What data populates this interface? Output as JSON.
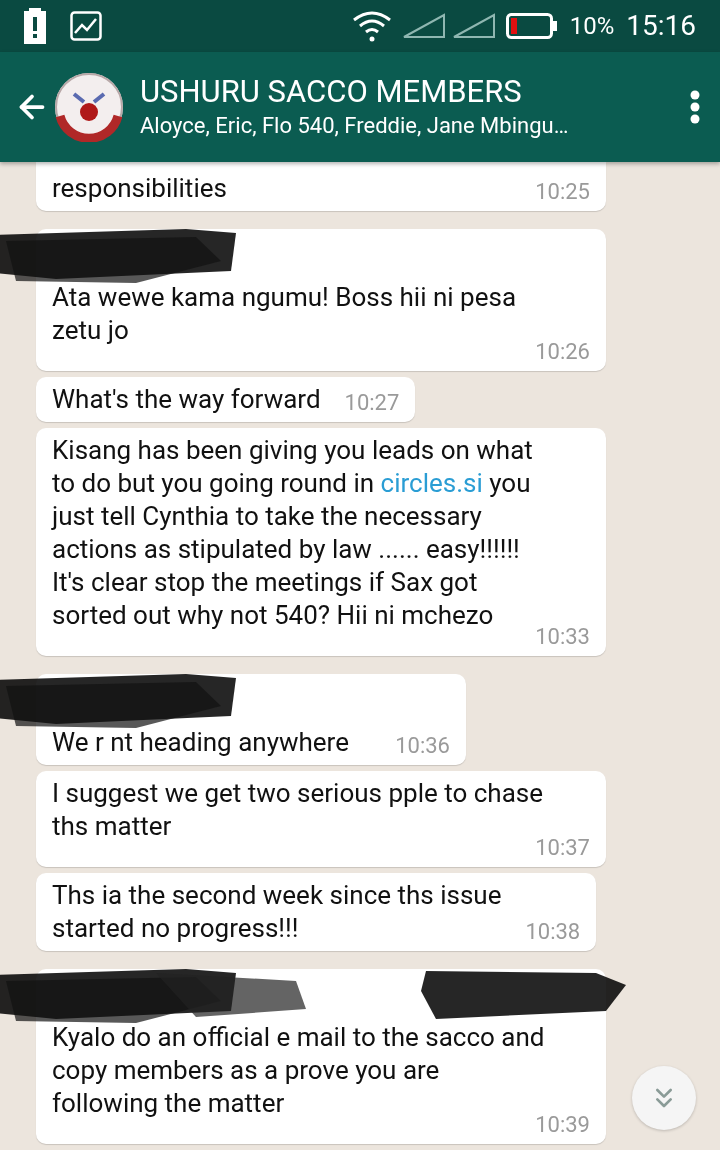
{
  "status_bar": {
    "battery": "10%",
    "time": "15:16"
  },
  "header": {
    "title": "USHURU SACCO MEMBERS",
    "subtitle": "Aloyce, Eric, Flo 540, Freddie, Jane Mbingu…"
  },
  "messages": [
    {
      "sender_redacted": false,
      "continued": true,
      "parts": [
        {
          "kind": "text",
          "text": "responsibilities"
        }
      ],
      "time": "10:25"
    },
    {
      "sender_redacted": true,
      "continued": false,
      "parts": [
        {
          "kind": "text",
          "text": "Ata wewe kama ngumu! Boss hii ni pesa\nzetu jo"
        }
      ],
      "time": "10:26"
    },
    {
      "sender_redacted": false,
      "continued": false,
      "parts": [
        {
          "kind": "text",
          "text": "What's the way forward"
        }
      ],
      "time": "10:27"
    },
    {
      "sender_redacted": false,
      "continued": false,
      "parts": [
        {
          "kind": "text",
          "text": "Kisang has been giving you leads on what\nto do but you going round in "
        },
        {
          "kind": "link",
          "text": "circles.si"
        },
        {
          "kind": "text",
          "text": " you\njust tell Cynthia to take the necessary\nactions as stipulated by law ...... easy!!!!!!\nIt's clear stop the meetings if Sax got\nsorted out why not 540? Hii ni mchezo"
        }
      ],
      "time": "10:33"
    },
    {
      "sender_redacted": true,
      "continued": false,
      "parts": [
        {
          "kind": "text",
          "text": "We r nt heading anywhere"
        }
      ],
      "time": "10:36"
    },
    {
      "sender_redacted": false,
      "continued": false,
      "parts": [
        {
          "kind": "text",
          "text": "I suggest we get two serious pple to chase\nths matter"
        }
      ],
      "time": "10:37"
    },
    {
      "sender_redacted": false,
      "continued": false,
      "parts": [
        {
          "kind": "text",
          "text": "Ths ia the second week since ths issue\nstarted no progress!!!"
        }
      ],
      "time": "10:38"
    },
    {
      "sender_redacted": true,
      "continued": false,
      "parts": [
        {
          "kind": "text",
          "text": "Kyalo do an official e mail to the sacco and\ncopy members as a prove you are\nfollowing the matter"
        }
      ],
      "time": "10:39"
    }
  ]
}
